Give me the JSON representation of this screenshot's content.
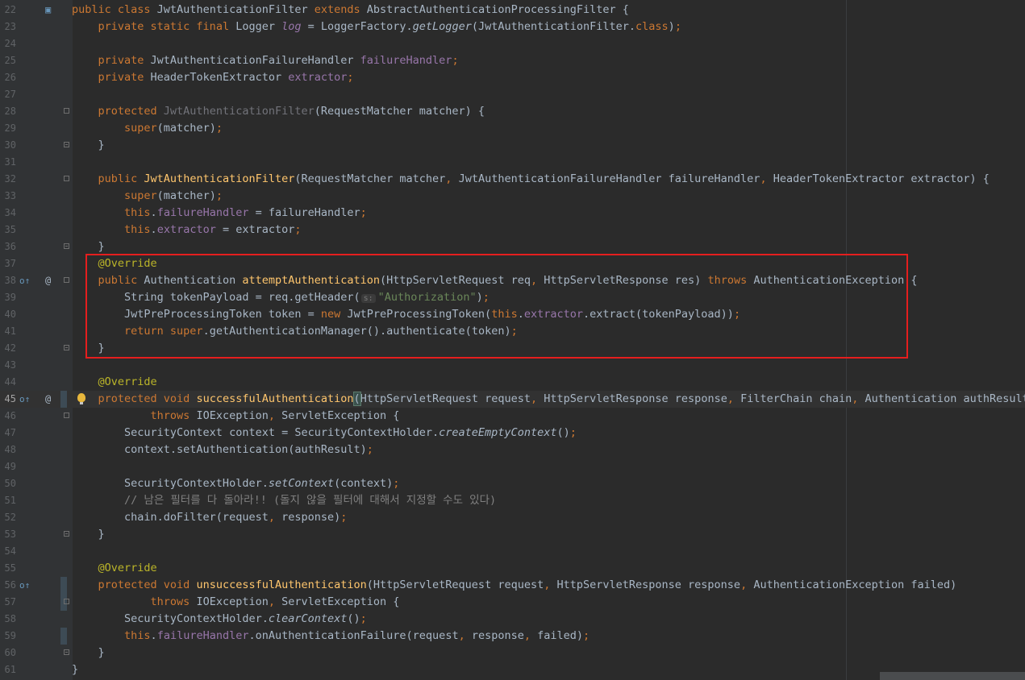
{
  "editor": {
    "lines": [
      {
        "num": "22",
        "html": "<span class='kw'>public class </span>JwtAuthenticationFilter <span class='kw'>extends </span>AbstractAuthenticationProcessingFilter {",
        "g1": "",
        "g2": "",
        "fold": ""
      },
      {
        "num": "23",
        "html": "    <span class='kw'>private static final </span>Logger <span class='st'>log </span>= LoggerFactory.<span class='it'>getLogger</span>(JwtAuthenticationFilter.<span class='kw'>class</span>)<span class='kw'>;</span>",
        "g1": "",
        "g2": "",
        "fold": ""
      },
      {
        "num": "24",
        "html": "",
        "g1": "",
        "g2": "",
        "fold": ""
      },
      {
        "num": "25",
        "html": "    <span class='kw'>private </span>JwtAuthenticationFailureHandler <span class='fld'>failureHandler</span><span class='kw'>;</span>",
        "g1": "",
        "g2": "",
        "fold": ""
      },
      {
        "num": "26",
        "html": "    <span class='kw'>private </span>HeaderTokenExtractor <span class='fld'>extractor</span><span class='kw'>;</span>",
        "g1": "",
        "g2": "",
        "fold": ""
      },
      {
        "num": "27",
        "html": "",
        "g1": "",
        "g2": "",
        "fold": ""
      },
      {
        "num": "28",
        "html": "    <span class='kw'>protected </span><span class='gray'>JwtAuthenticationFilter</span>(RequestMatcher matcher) {",
        "g1": "",
        "g2": "",
        "fold": "start"
      },
      {
        "num": "29",
        "html": "        <span class='kw'>super</span>(matcher)<span class='kw'>;</span>",
        "g1": "",
        "g2": "",
        "fold": ""
      },
      {
        "num": "30",
        "html": "    }",
        "g1": "",
        "g2": "",
        "fold": "end"
      },
      {
        "num": "31",
        "html": "",
        "g1": "",
        "g2": "",
        "fold": ""
      },
      {
        "num": "32",
        "html": "    <span class='kw'>public </span><span class='fn'>JwtAuthenticationFilter</span>(RequestMatcher matcher<span class='kw'>, </span>JwtAuthenticationFailureHandler failureHandler<span class='kw'>, </span>HeaderTokenExtractor extractor) {",
        "g1": "",
        "g2": "",
        "fold": "start"
      },
      {
        "num": "33",
        "html": "        <span class='kw'>super</span>(matcher)<span class='kw'>;</span>",
        "g1": "",
        "g2": "",
        "fold": ""
      },
      {
        "num": "34",
        "html": "        <span class='kw'>this</span>.<span class='fld'>failureHandler </span>= failureHandler<span class='kw'>;</span>",
        "g1": "",
        "g2": "",
        "fold": ""
      },
      {
        "num": "35",
        "html": "        <span class='kw'>this</span>.<span class='fld'>extractor </span>= extractor<span class='kw'>;</span>",
        "g1": "",
        "g2": "",
        "fold": ""
      },
      {
        "num": "36",
        "html": "    }",
        "g1": "",
        "g2": "",
        "fold": "end"
      },
      {
        "num": "37",
        "html": "    <span class='ann'>@Override</span>",
        "g1": "",
        "g2": "",
        "fold": ""
      },
      {
        "num": "38",
        "html": "    <span class='kw'>public </span>Authentication <span class='fn'>attemptAuthentication</span>(HttpServletRequest req<span class='kw'>, </span>HttpServletResponse res) <span class='kw'>throws </span>AuthenticationException {",
        "g1": "o↑",
        "g2": "@",
        "fold": "start"
      },
      {
        "num": "39",
        "html": "        String tokenPayload = req.getHeader(<span class='hint'>s:</span><span class='str'>\"Authorization\"</span>)<span class='kw'>;</span>",
        "g1": "",
        "g2": "",
        "fold": ""
      },
      {
        "num": "40",
        "html": "        JwtPreProcessingToken token = <span class='kw'>new </span>JwtPreProcessingToken(<span class='kw'>this</span>.<span class='fld'>extractor</span>.extract(tokenPayload))<span class='kw'>;</span>",
        "g1": "",
        "g2": "",
        "fold": ""
      },
      {
        "num": "41",
        "html": "        <span class='kw'>return super</span>.getAuthenticationManager().authenticate(token)<span class='kw'>;</span>",
        "g1": "",
        "g2": "",
        "fold": ""
      },
      {
        "num": "42",
        "html": "    }",
        "g1": "",
        "g2": "",
        "fold": "end"
      },
      {
        "num": "43",
        "html": "",
        "g1": "",
        "g2": "",
        "fold": ""
      },
      {
        "num": "44",
        "html": "    <span class='ann'>@Override</span>",
        "g1": "",
        "g2": "",
        "fold": ""
      },
      {
        "num": "45",
        "html": "    <span class='kw'>protected void </span><span class='fn'>successfulAuthentication</span><span class='bracket-hl'>(</span>HttpServletRequest request<span class='kw'>, </span>HttpServletResponse response<span class='kw'>, </span>FilterChain chain<span class='kw'>, </span>Authentication authResult<span class='bracket-hl'>)</span>",
        "g1": "o↑",
        "g2": "@",
        "fold": "",
        "current": true,
        "bulb": true,
        "change": true
      },
      {
        "num": "46",
        "html": "            <span class='kw'>throws </span>IOException<span class='kw'>, </span>ServletException {",
        "g1": "",
        "g2": "",
        "fold": "start"
      },
      {
        "num": "47",
        "html": "        SecurityContext context = SecurityContextHolder.<span class='it'>createEmptyContext</span>()<span class='kw'>;</span>",
        "g1": "",
        "g2": "",
        "fold": ""
      },
      {
        "num": "48",
        "html": "        context.setAuthentication(authResult)<span class='kw'>;</span>",
        "g1": "",
        "g2": "",
        "fold": ""
      },
      {
        "num": "49",
        "html": "",
        "g1": "",
        "g2": "",
        "fold": ""
      },
      {
        "num": "50",
        "html": "        SecurityContextHolder.<span class='it'>setContext</span>(context)<span class='kw'>;</span>",
        "g1": "",
        "g2": "",
        "fold": ""
      },
      {
        "num": "51",
        "html": "        <span class='cm'>// 남은 필터를 다 돌아라!! (돌지 않을 필터에 대해서 지정할 수도 있다)</span>",
        "g1": "",
        "g2": "",
        "fold": ""
      },
      {
        "num": "52",
        "html": "        chain.doFilter(request<span class='kw'>, </span>response)<span class='kw'>;</span>",
        "g1": "",
        "g2": "",
        "fold": ""
      },
      {
        "num": "53",
        "html": "    }",
        "g1": "",
        "g2": "",
        "fold": "end"
      },
      {
        "num": "54",
        "html": "",
        "g1": "",
        "g2": "",
        "fold": ""
      },
      {
        "num": "55",
        "html": "    <span class='ann'>@Override</span>",
        "g1": "",
        "g2": "",
        "fold": ""
      },
      {
        "num": "56",
        "html": "    <span class='kw'>protected void </span><span class='fn'>unsuccessfulAuthentication</span>(HttpServletRequest request<span class='kw'>, </span>HttpServletResponse response<span class='kw'>, </span>AuthenticationException failed)",
        "g1": "o↑",
        "g2": "",
        "fold": "",
        "change": true
      },
      {
        "num": "57",
        "html": "            <span class='kw'>throws </span>IOException<span class='kw'>, </span>ServletException {",
        "g1": "",
        "g2": "",
        "fold": "start",
        "change": true
      },
      {
        "num": "58",
        "html": "        SecurityContextHolder.<span class='it'>clearContext</span>()<span class='kw'>;</span>",
        "g1": "",
        "g2": "",
        "fold": ""
      },
      {
        "num": "59",
        "html": "        <span class='kw'>this</span>.<span class='fld'>failureHandler</span>.onAuthenticationFailure(request<span class='kw'>, </span>response<span class='kw'>, </span>failed)<span class='kw'>;</span>",
        "g1": "",
        "g2": "",
        "fold": "",
        "change": true
      },
      {
        "num": "60",
        "html": "    }",
        "g1": "",
        "g2": "",
        "fold": "end"
      },
      {
        "num": "61",
        "html": "}",
        "g1": "",
        "g2": "",
        "fold": ""
      }
    ]
  },
  "colors": {
    "background": "#2b2b2b",
    "gutter": "#313335",
    "keyword": "#cc7832",
    "function": "#ffc66d",
    "field": "#9876aa",
    "string": "#6a8759",
    "annotation": "#bbb529",
    "comment": "#808080",
    "highlight_box": "#e51e1e"
  }
}
